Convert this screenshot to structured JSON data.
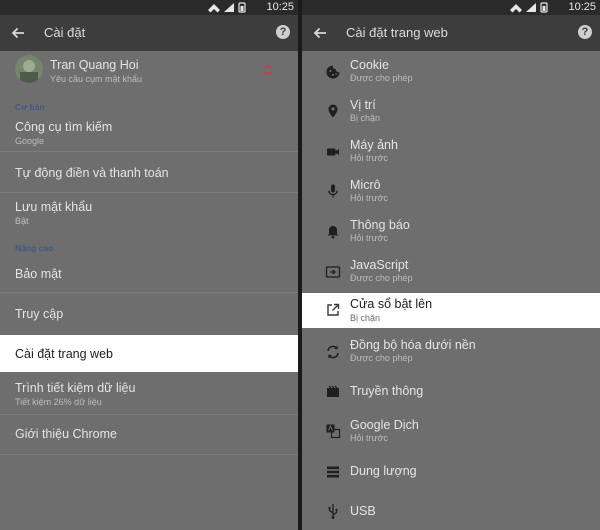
{
  "status": {
    "time_left": "10:25",
    "time_right": "10:25"
  },
  "left": {
    "title": "Cài đặt",
    "account": {
      "name": "Tran Quang Hoi",
      "subtitle": "Yêu cầu cụm mật khẩu"
    },
    "section_basic": "Cơ bản",
    "section_advanced": "Nâng cao",
    "items": [
      {
        "label": "Công cụ tìm kiếm",
        "sub": "Google"
      },
      {
        "label": "Tự động điền và thanh toán",
        "sub": ""
      },
      {
        "label": "Lưu mật khẩu",
        "sub": "Bật"
      },
      {
        "label": "Bảo mật",
        "sub": ""
      },
      {
        "label": "Truy cập",
        "sub": ""
      },
      {
        "label": "Cài đặt trang web",
        "sub": ""
      },
      {
        "label": "Trình tiết kiệm dữ liệu",
        "sub": "Tiết kiệm 26% dữ liệu"
      },
      {
        "label": "Giới thiệu Chrome",
        "sub": ""
      }
    ]
  },
  "right": {
    "title": "Cài đặt trang web",
    "items": [
      {
        "label": "Cookie",
        "sub": "Được cho phép",
        "icon": "cookie-icon"
      },
      {
        "label": "Vị trí",
        "sub": "Bị chặn",
        "icon": "location-icon"
      },
      {
        "label": "Máy ảnh",
        "sub": "Hỏi trước",
        "icon": "camera-icon"
      },
      {
        "label": "Micrô",
        "sub": "Hỏi trước",
        "icon": "microphone-icon"
      },
      {
        "label": "Thông báo",
        "sub": "Hỏi trước",
        "icon": "bell-icon"
      },
      {
        "label": "JavaScript",
        "sub": "Được cho phép",
        "icon": "javascript-icon"
      },
      {
        "label": "Cửa sổ bật lên",
        "sub": "Bị chặn",
        "icon": "popup-icon"
      },
      {
        "label": "Đồng bộ hóa dưới nền",
        "sub": "Được cho phép",
        "icon": "sync-icon"
      },
      {
        "label": "Truyền thông",
        "sub": "",
        "icon": "media-icon"
      },
      {
        "label": "Google Dịch",
        "sub": "Hỏi trước",
        "icon": "translate-icon"
      },
      {
        "label": "Dung lượng",
        "sub": "",
        "icon": "storage-icon"
      },
      {
        "label": "USB",
        "sub": "",
        "icon": "usb-icon"
      }
    ]
  }
}
